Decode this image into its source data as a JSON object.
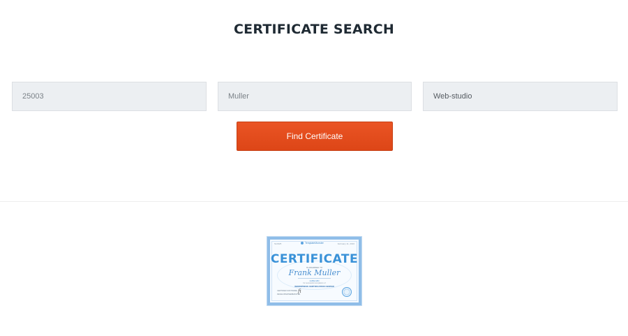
{
  "page": {
    "title": "CERTIFICATE SEARCH"
  },
  "search": {
    "fields": [
      {
        "placeholder": "25003"
      },
      {
        "placeholder": "Muller"
      },
      {
        "placeholder": "Web-studio"
      }
    ],
    "button_label": "Find Certificate"
  },
  "certificate_preview": {
    "number": "SL0925",
    "brand": "TemplateMonster",
    "date": "February 11, 2016",
    "heading": "CERTIFICATE",
    "awarded_text": "IS AWARDED TO",
    "signature": "Frank Muller",
    "recipient": "LUKE HIN",
    "completion_text": "for successful completion of",
    "program": "WORDPRESS CERTIFICATION CENTER",
    "footer_line1": "CERTIFIED SOFTWARE",
    "footer_line2": "DEVELOPER/WEBMASTER",
    "colors": {
      "accent": "#3a92d8",
      "border": "#8fbde8"
    }
  },
  "colors": {
    "button": "#e24d1b",
    "field_bg": "#eceff2",
    "title": "#1f2a33"
  }
}
